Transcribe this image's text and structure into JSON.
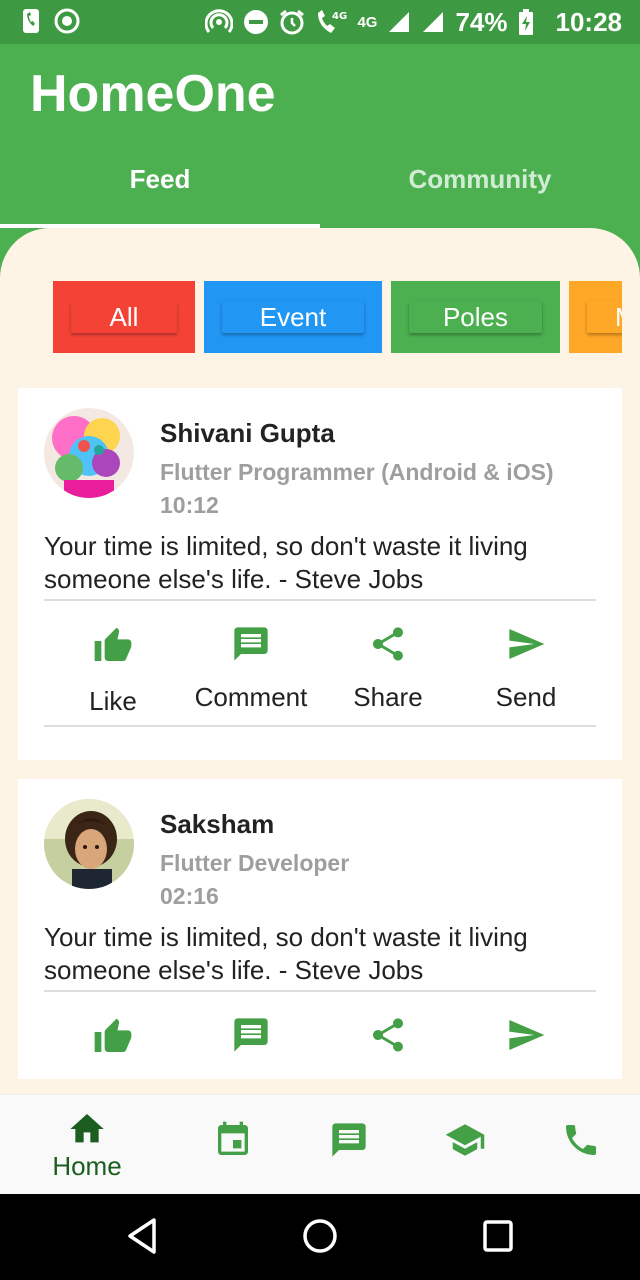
{
  "status": {
    "network": "4G",
    "battery": "74%",
    "time": "10:28"
  },
  "app": {
    "title": "HomeOne"
  },
  "tabs": [
    {
      "label": "Feed",
      "selected": true
    },
    {
      "label": "Community",
      "selected": false
    }
  ],
  "chips": [
    {
      "label": "All",
      "color": "#f44336"
    },
    {
      "label": "Event",
      "color": "#2196f3"
    },
    {
      "label": "Poles",
      "color": "#4caf50"
    },
    {
      "label": "M",
      "color": "#ffa726"
    }
  ],
  "posts": [
    {
      "name": "Shivani Gupta",
      "role": "Flutter Programmer (Android & iOS)",
      "time": "10:12",
      "quote": "Your time is limited, so don't waste it living someone else's life. - Steve Jobs"
    },
    {
      "name": "Saksham",
      "role": "Flutter Developer",
      "time": "02:16",
      "quote": "Your time is limited, so don't waste it living someone else's life. - Steve Jobs"
    }
  ],
  "actions": {
    "like": "Like",
    "comment": "Comment",
    "share": "Share",
    "send": "Send"
  },
  "bottom_nav": {
    "home_label": "Home"
  },
  "colors": {
    "primary": "#4caf50",
    "primary_dark": "#3e9a42",
    "icon": "#43a047",
    "background": "#fdf4e6"
  }
}
